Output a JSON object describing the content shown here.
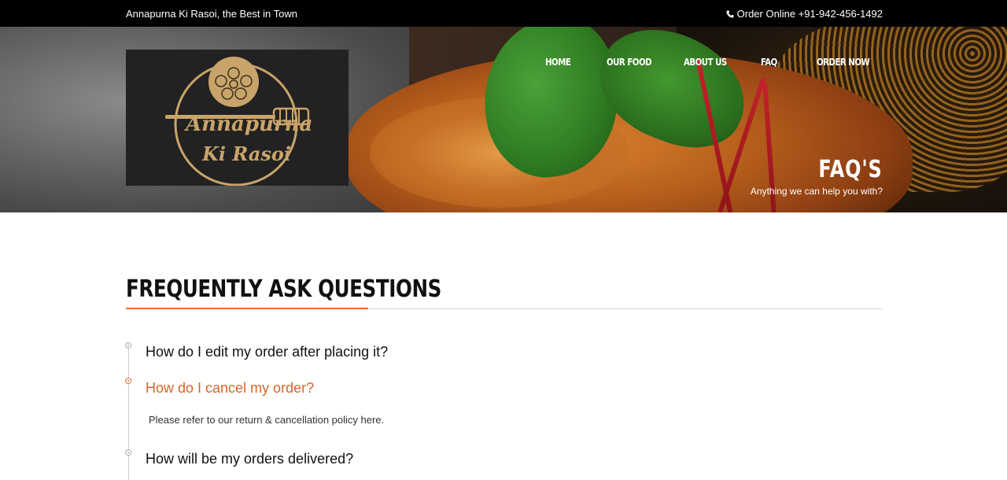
{
  "topbar": {
    "tagline": "Annapurna Ki Rasoi, the Best in Town",
    "contact_label": "Order Online +91-942-456-1492",
    "phone_icon": "phone-icon"
  },
  "logo": {
    "line1": "Annapurna",
    "line2": "Ki Rasoi",
    "accent_color": "#c9a46a"
  },
  "nav": {
    "items": [
      {
        "label": "HOME"
      },
      {
        "label": "OUR FOOD"
      },
      {
        "label": "ABOUT US"
      },
      {
        "label": "FAQ"
      },
      {
        "label": "ORDER NOW"
      }
    ]
  },
  "hero": {
    "title": "FAQ'S",
    "subtitle": "Anything we can help you with?"
  },
  "main": {
    "section_title": "FREQUENTLY ASK QUESTIONS",
    "accent_color": "#e07030",
    "faqs": [
      {
        "question": "How do I edit my order after placing it?",
        "expanded": false
      },
      {
        "question": "How do I cancel my order?",
        "expanded": true,
        "answer": "Please refer to our return & cancellation policy here."
      },
      {
        "question": "How will be my orders delivered?",
        "expanded": false
      }
    ]
  }
}
